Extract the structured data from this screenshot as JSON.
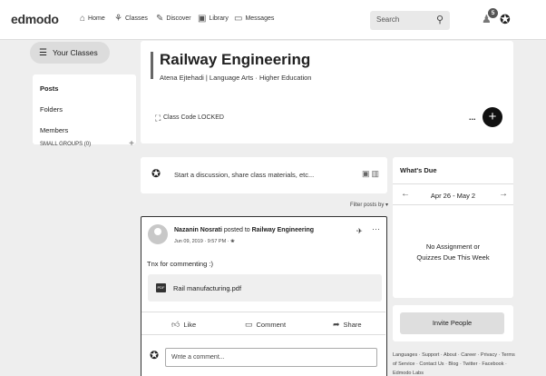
{
  "app": {
    "logo": "edmodo"
  },
  "nav": {
    "items": [
      {
        "label": "Home",
        "icon": "home-icon"
      },
      {
        "label": "Classes",
        "icon": "classes-icon"
      },
      {
        "label": "Discover",
        "icon": "discover-icon"
      },
      {
        "label": "Library",
        "icon": "library-icon"
      },
      {
        "label": "Messages",
        "icon": "messages-icon"
      }
    ],
    "search_placeholder": "Search",
    "notification_count": "5"
  },
  "sidebar": {
    "your_classes": "Your Classes",
    "items": [
      {
        "label": "Posts",
        "active": true
      },
      {
        "label": "Folders",
        "active": false
      },
      {
        "label": "Members",
        "active": false
      }
    ],
    "small_groups": "SMALL GROUPS (0)",
    "small_groups_add": "+"
  },
  "class": {
    "title": "Railway Engineering",
    "subtitle": "Atena Ejtehadi | Language Arts · Higher Education",
    "code": "Class Code LOCKED",
    "more": "...",
    "add": "+"
  },
  "composer": {
    "placeholder": "Start a discussion, share class materials, etc..."
  },
  "filter": {
    "label": "Filter posts by ▾"
  },
  "post": {
    "author": "Nazanin Nosrati",
    "posted_to_text": " posted to ",
    "group": "Railway Engineering",
    "date": "Jun 09, 2019 · 9:57 PM ·",
    "more": "···",
    "body": "Tnx for commenting :)",
    "attachment": "Rail manufacturing.pdf",
    "attachment_type": "PDF",
    "actions": {
      "like": "Like",
      "comment": "Comment",
      "share": "Share"
    },
    "comment_placeholder": "Write a comment..."
  },
  "due": {
    "title": "What's Due",
    "range": "Apr 26 - May 2",
    "prev": "←",
    "next": "→",
    "empty_line1": "No Assignment or",
    "empty_line2": "Quizzes Due This Week"
  },
  "invite": {
    "label": "Invite People"
  },
  "footer": {
    "links": "Languages · Support · About · Career · Privacy · Terms of Service · Contact Us · Blog · Twitter · Facebook · Edmodo Labs"
  }
}
